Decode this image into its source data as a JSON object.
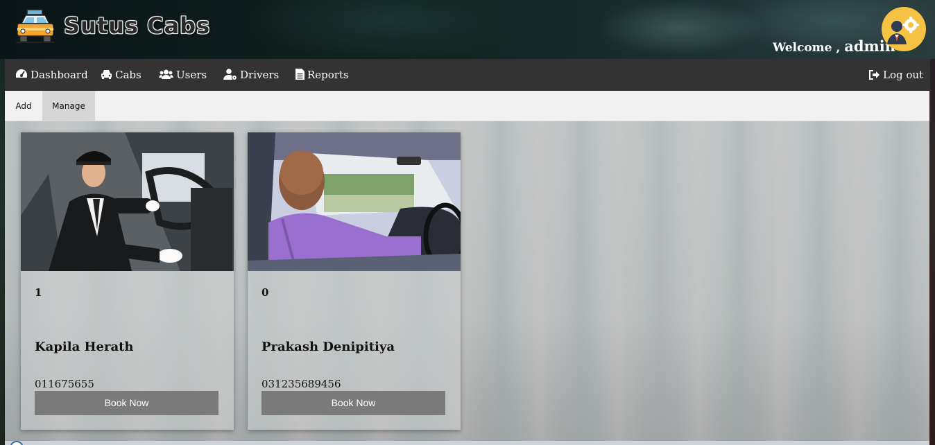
{
  "header": {
    "brand": "Sutus Cabs",
    "welcome_prefix": "Welcome ,",
    "username": "admin"
  },
  "nav": {
    "items": [
      {
        "label": "Dashboard",
        "icon": "tachometer-icon"
      },
      {
        "label": "Cabs",
        "icon": "car-icon"
      },
      {
        "label": "Users",
        "icon": "users-icon"
      },
      {
        "label": "Drivers",
        "icon": "driver-icon"
      },
      {
        "label": "Reports",
        "icon": "file-icon"
      }
    ],
    "logout": {
      "label": "Log out",
      "icon": "sign-out-icon"
    }
  },
  "tabs": [
    {
      "label": "Add",
      "active": false
    },
    {
      "label": "Manage",
      "active": true
    }
  ],
  "drivers": [
    {
      "count": "1",
      "name": "Kapila Herath",
      "phone": "011675655",
      "button": "Book Now"
    },
    {
      "count": "0",
      "name": "Prakash Denipitiya",
      "phone": "031235689456",
      "button": "Book Now"
    }
  ],
  "colors": {
    "nav_bg": "#333333",
    "avatar_bg": "#f6c244",
    "button_bg": "#7a7a7a"
  }
}
